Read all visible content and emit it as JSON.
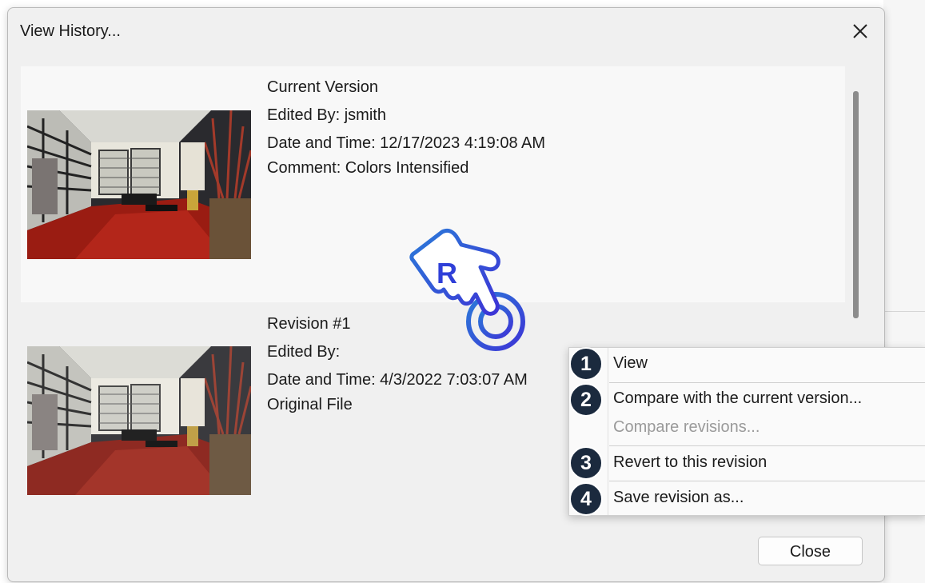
{
  "dialog": {
    "title": "View History...",
    "close_icon": "close-icon",
    "close_button_label": "Close"
  },
  "versions": [
    {
      "heading": "Current Version",
      "edited_by": "Edited By: jsmith",
      "date_time": "Date and Time: 12/17/2023 4:19:08 AM",
      "comment": "Comment: Colors Intensified"
    },
    {
      "heading": "Revision #1",
      "edited_by": "Edited By:",
      "date_time": "Date and Time: 4/3/2022 7:03:07 AM",
      "comment": "Original File"
    }
  ],
  "context_menu": {
    "items": [
      {
        "label": "View",
        "badge": "1",
        "enabled": true
      },
      {
        "label": "Compare with the current version...",
        "badge": "2",
        "enabled": true
      },
      {
        "label": "Compare revisions...",
        "badge": "",
        "enabled": false
      },
      {
        "label": "Revert to this revision",
        "badge": "3",
        "enabled": true
      },
      {
        "label": "Save revision as...",
        "badge": "4",
        "enabled": true
      }
    ]
  },
  "pointer": {
    "icon": "hand-pointer-icon",
    "letter": "R",
    "color": "#2f3fd8"
  },
  "colors": {
    "badge_bg": "#1b2a3e",
    "floor_red": "#8a1a12"
  }
}
